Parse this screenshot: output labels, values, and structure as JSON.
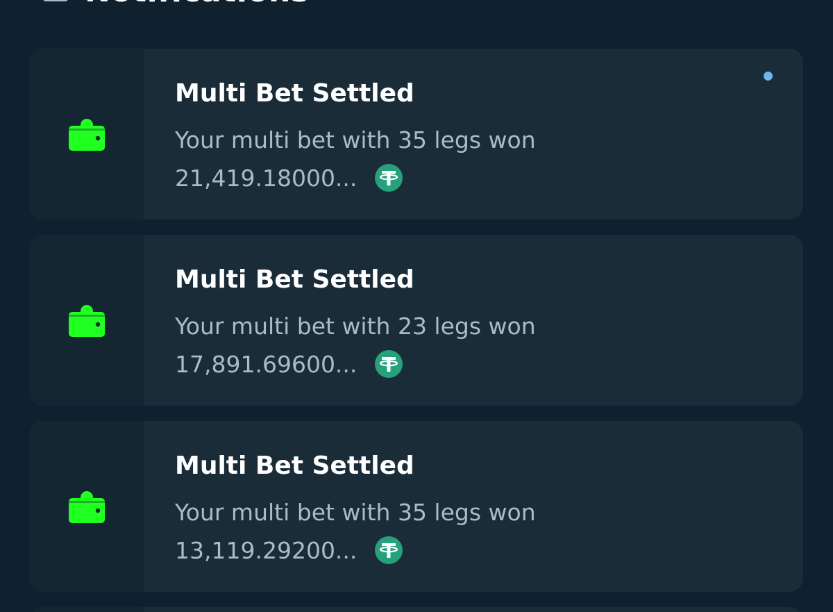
{
  "header": {
    "title": "Notifications",
    "bell_icon": "bell-icon",
    "close_icon": "close-icon"
  },
  "colors": {
    "background": "#0f212e",
    "card_body": "#1a2c38",
    "card_side": "#132632",
    "title_text": "#ffffff",
    "message_text": "#a9bcc9",
    "wallet_icon": "#1fff20",
    "usdt_icon": "#26a17b",
    "unread_dot": "#6cb4f2"
  },
  "notifications": [
    {
      "icon": "wallet-icon",
      "title": "Multi Bet Settled",
      "message": "Your multi bet with 35 legs won",
      "amount": "21,419.18000...",
      "currency_icon": "usdt-icon",
      "unread": true
    },
    {
      "icon": "wallet-icon",
      "title": "Multi Bet Settled",
      "message": "Your multi bet with 23 legs won",
      "amount": "17,891.69600...",
      "currency_icon": "usdt-icon",
      "unread": false
    },
    {
      "icon": "wallet-icon",
      "title": "Multi Bet Settled",
      "message": "Your multi bet with 35 legs won",
      "amount": "13,119.29200...",
      "currency_icon": "usdt-icon",
      "unread": false
    }
  ]
}
